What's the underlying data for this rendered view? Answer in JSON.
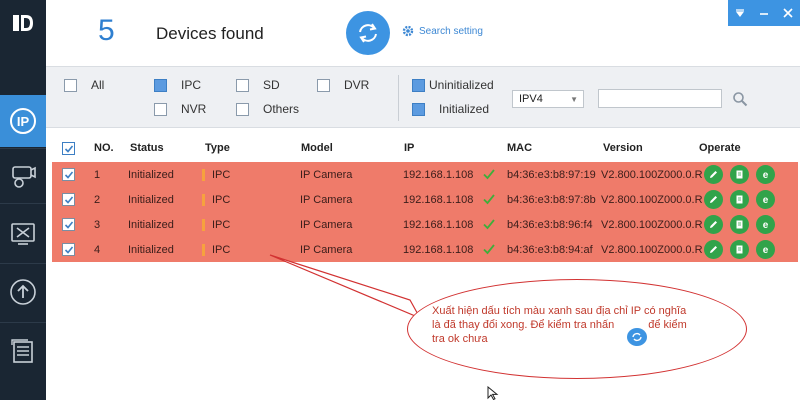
{
  "header": {
    "device_count": "5",
    "devices_found_label": "Devices found",
    "search_setting_label": "Search setting"
  },
  "filters": {
    "all": "All",
    "ipc": "IPC",
    "sd": "SD",
    "dvr": "DVR",
    "nvr": "NVR",
    "others": "Others",
    "uninitialized": "Uninitialized",
    "initialized": "Initialized",
    "ip_version": "IPV4",
    "search_value": ""
  },
  "table": {
    "headers": {
      "no": "NO.",
      "status": "Status",
      "type": "Type",
      "model": "Model",
      "ip": "IP",
      "mac": "MAC",
      "version": "Version",
      "operate": "Operate"
    },
    "rows": [
      {
        "no": "1",
        "status": "Initialized",
        "type": "IPC",
        "model": "IP Camera",
        "ip": "192.168.1.108",
        "mac": "b4:36:e3:b8:97:19",
        "version": "V2.800.100Z000.0.R"
      },
      {
        "no": "2",
        "status": "Initialized",
        "type": "IPC",
        "model": "IP Camera",
        "ip": "192.168.1.108",
        "mac": "b4:36:e3:b8:97:8b",
        "version": "V2.800.100Z000.0.R"
      },
      {
        "no": "3",
        "status": "Initialized",
        "type": "IPC",
        "model": "IP Camera",
        "ip": "192.168.1.108",
        "mac": "b4:36:e3:b8:96:f4",
        "version": "V2.800.100Z000.0.R"
      },
      {
        "no": "4",
        "status": "Initialized",
        "type": "IPC",
        "model": "IP Camera",
        "ip": "192.168.1.108",
        "mac": "b4:36:e3:b8:94:af",
        "version": "V2.800.100Z000.0.R"
      }
    ]
  },
  "annotation": {
    "line1": "Xuất hiện dấu tích màu xanh sau địa chỉ IP có nghĩa",
    "line2": "là đã thay đổi xong. Để kiểm tra nhấn",
    "line2b": "để kiểm",
    "line3": "tra ok chưa"
  },
  "colors": {
    "sidebar_bg": "#1a2633",
    "accent_blue": "#3d94e2",
    "row_highlight": "#ef7b6a",
    "operate_green": "#31a34a",
    "annotation_red": "#d23232"
  }
}
